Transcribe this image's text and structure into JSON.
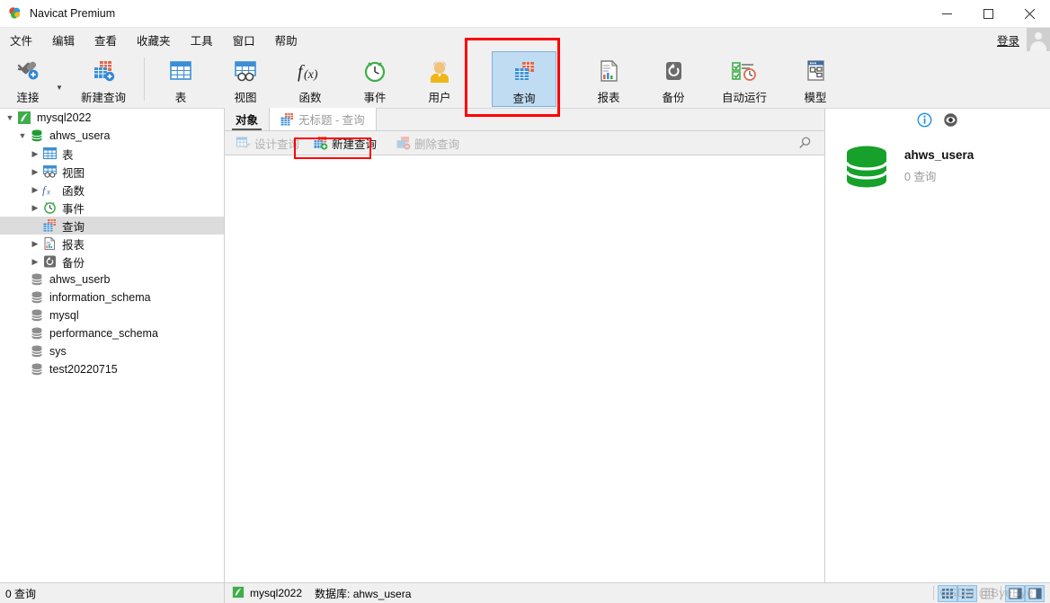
{
  "window": {
    "title": "Navicat Premium",
    "app_icon": "navicat-logo-icon",
    "minimize": "—",
    "maximize": "☐",
    "close": "✕"
  },
  "menubar": {
    "items": [
      {
        "label": "文件",
        "name": "menu-file"
      },
      {
        "label": "编辑",
        "name": "menu-edit"
      },
      {
        "label": "查看",
        "name": "menu-view"
      },
      {
        "label": "收藏夹",
        "name": "menu-favorites"
      },
      {
        "label": "工具",
        "name": "menu-tools"
      },
      {
        "label": "窗口",
        "name": "menu-window"
      },
      {
        "label": "帮助",
        "name": "menu-help"
      }
    ],
    "login_label": "登录"
  },
  "toolbar": {
    "items": [
      {
        "label": "连接",
        "icon": "connection-plug-icon",
        "selected": false
      },
      {
        "label": "新建查询",
        "icon": "new-query-icon",
        "selected": false
      },
      {
        "label": "表",
        "icon": "table-icon",
        "selected": false
      },
      {
        "label": "视图",
        "icon": "view-icon",
        "selected": false
      },
      {
        "label": "函数",
        "icon": "function-fx-icon",
        "selected": false
      },
      {
        "label": "事件",
        "icon": "event-clock-icon",
        "selected": false
      },
      {
        "label": "用户",
        "icon": "user-icon",
        "selected": false
      },
      {
        "label": "查询",
        "icon": "query-icon",
        "selected": true
      },
      {
        "label": "报表",
        "icon": "report-icon",
        "selected": false
      },
      {
        "label": "备份",
        "icon": "backup-icon",
        "selected": false
      },
      {
        "label": "自动运行",
        "icon": "automation-icon",
        "selected": false
      },
      {
        "label": "模型",
        "icon": "model-icon",
        "selected": false
      }
    ],
    "highlight_color": "#ff0000"
  },
  "sidebar": {
    "items": [
      {
        "label": "mysql2022",
        "icon": "connection-icon",
        "indent": 0,
        "twisty": "expanded",
        "selected": false
      },
      {
        "label": "ahws_usera",
        "icon": "database-icon",
        "indent": 1,
        "twisty": "expanded",
        "selected": false
      },
      {
        "label": "表",
        "icon": "table-icon",
        "indent": 2,
        "twisty": "collapsed",
        "selected": false
      },
      {
        "label": "视图",
        "icon": "view-icon",
        "indent": 2,
        "twisty": "collapsed",
        "selected": false
      },
      {
        "label": "函数",
        "icon": "function-fx-icon",
        "indent": 2,
        "twisty": "collapsed",
        "selected": false
      },
      {
        "label": "事件",
        "icon": "event-clock-icon",
        "indent": 2,
        "twisty": "collapsed",
        "selected": false
      },
      {
        "label": "查询",
        "icon": "query-icon",
        "indent": 2,
        "twisty": "none",
        "selected": true
      },
      {
        "label": "报表",
        "icon": "report-icon",
        "indent": 2,
        "twisty": "collapsed",
        "selected": false
      },
      {
        "label": "备份",
        "icon": "backup-icon",
        "indent": 2,
        "twisty": "collapsed",
        "selected": false
      },
      {
        "label": "ahws_userb",
        "icon": "database-icon",
        "indent": 1,
        "twisty": "none",
        "selected": false
      },
      {
        "label": "information_schema",
        "icon": "database-icon",
        "indent": 1,
        "twisty": "none",
        "selected": false
      },
      {
        "label": "mysql",
        "icon": "database-icon",
        "indent": 1,
        "twisty": "none",
        "selected": false
      },
      {
        "label": "performance_schema",
        "icon": "database-icon",
        "indent": 1,
        "twisty": "none",
        "selected": false
      },
      {
        "label": "sys",
        "icon": "database-icon",
        "indent": 1,
        "twisty": "none",
        "selected": false
      },
      {
        "label": "test20220715",
        "icon": "database-icon",
        "indent": 1,
        "twisty": "none",
        "selected": false
      }
    ]
  },
  "content": {
    "tabs": [
      {
        "label": "对象",
        "icon": null,
        "active": true
      },
      {
        "label": "无标题 - 查询",
        "icon": "query-icon",
        "active": false
      }
    ],
    "object_toolbar": [
      {
        "label": "设计查询",
        "icon": "design-query-icon",
        "enabled": false,
        "highlighted": false
      },
      {
        "label": "新建查询",
        "icon": "new-query-icon",
        "enabled": true,
        "highlighted": true
      },
      {
        "label": "删除查询",
        "icon": "delete-query-icon",
        "enabled": false,
        "highlighted": false
      }
    ],
    "search_icon": "search-icon"
  },
  "infopanel": {
    "info_icon": "info-icon",
    "preview_icon": "preview-eye-icon",
    "db_icon": "database-big-icon",
    "db_name": "ahws_usera",
    "db_sub": "0 查询"
  },
  "statusbar": {
    "left_text": "0 查询",
    "conn_icon": "connection-icon",
    "conn_name": "mysql2022",
    "db_text": "数据库: ahws_usera",
    "view_buttons": [
      {
        "name": "grid-view-button",
        "icon": "grid-icon",
        "active": true
      },
      {
        "name": "list-view-button",
        "icon": "list-icon",
        "active": true
      },
      {
        "name": "detail-view-button",
        "icon": "detail-icon",
        "active": false
      },
      {
        "name": "info-pane-button",
        "icon": "right-pane-icon",
        "active": true
      },
      {
        "name": "preview-pane-button",
        "icon": "preview-pane-icon",
        "active": true
      }
    ],
    "watermark": "CSDN @ByeBye"
  }
}
